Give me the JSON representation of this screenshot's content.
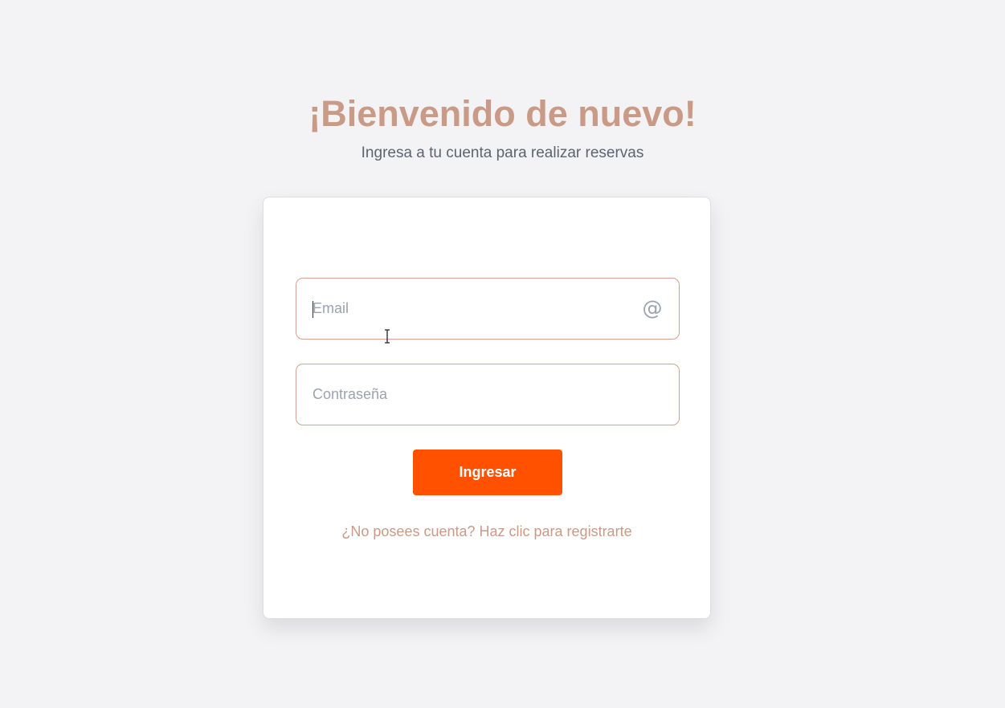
{
  "header": {
    "title": "¡Bienvenido de nuevo!",
    "subtitle": "Ingresa a tu cuenta para realizar reservas"
  },
  "form": {
    "email": {
      "placeholder": "Email",
      "value": "",
      "icon": "at-sign-icon",
      "icon_glyph": "@"
    },
    "password": {
      "placeholder": "Contraseña",
      "value": ""
    },
    "submit_label": "Ingresar",
    "register_link": "¿No posees cuenta? Haz clic para registrarte"
  },
  "colors": {
    "background": "#f3f3f5",
    "title": "#c99a86",
    "accent_button": "#ff5100",
    "field_border": "#d4a291"
  }
}
